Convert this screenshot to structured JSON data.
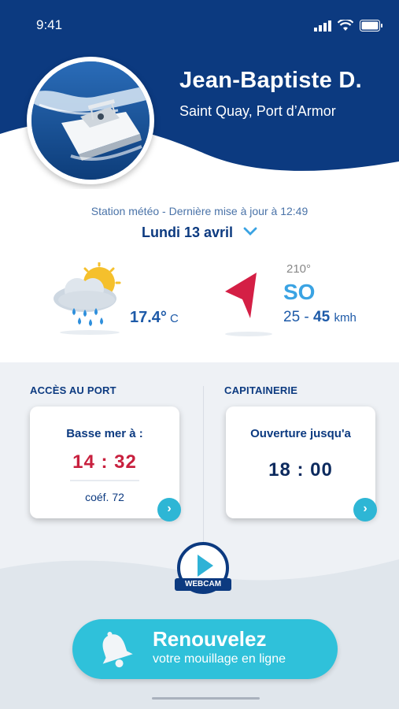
{
  "status_bar": {
    "time": "9:41"
  },
  "profile": {
    "name": "Jean-Baptiste D.",
    "port": "Saint Quay, Port d’Armor",
    "avatar_icon": "boat-photo"
  },
  "weather": {
    "station_label": "Station météo - Dernière mise à jour à 12:49",
    "date": "Lundi 13 avril",
    "condition_icon": "sun-cloud-rain-icon",
    "temperature": "17.4°",
    "temperature_unit": "C",
    "wind": {
      "degrees": "210°",
      "direction": "SO",
      "speed_min": "25 - ",
      "speed_max": "45",
      "speed_unit": "kmh"
    }
  },
  "port_access": {
    "section_title": "ACCÈS AU PORT",
    "card_title": "Basse mer à  :",
    "time": "14 : 32",
    "coef": "coéf. 72"
  },
  "harbour_office": {
    "section_title": "CAPITAINERIE",
    "card_title": "Ouverture jusqu'a",
    "time": "18 : 00"
  },
  "webcam": {
    "label": "WEBCAM"
  },
  "cta": {
    "title": "Renouvelez",
    "subtitle": "votre mouillage en ligne"
  },
  "colors": {
    "navy": "#0c3a80",
    "accent_red": "#c8203e",
    "accent_cyan": "#2fc1da",
    "sky_blue": "#3aa3e3"
  }
}
